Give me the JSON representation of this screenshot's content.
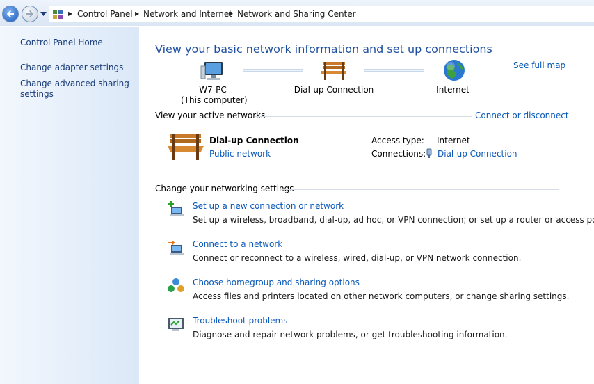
{
  "breadcrumb": {
    "items": [
      "Control Panel",
      "Network and Internet",
      "Network and Sharing Center"
    ]
  },
  "sidebar": {
    "items": [
      {
        "label": "Control Panel Home"
      },
      {
        "label": "Change adapter settings"
      },
      {
        "label": "Change advanced sharing settings"
      }
    ]
  },
  "main": {
    "title": "View your basic network information and set up connections",
    "see_full_map": "See full map",
    "map": {
      "computer_name": "W7-PC",
      "computer_sub": "(This computer)",
      "middle": "Dial-up Connection",
      "internet": "Internet"
    },
    "active_networks": {
      "heading": "View your active networks",
      "connect_link": "Connect or disconnect",
      "network_name": "Dial-up Connection",
      "network_type": "Public network",
      "access_type_label": "Access type:",
      "access_type_value": "Internet",
      "connections_label": "Connections:",
      "connections_value": "Dial-up Connection"
    },
    "settings": {
      "heading": "Change your networking settings",
      "tasks": [
        {
          "link": "Set up a new connection or network",
          "desc": "Set up a wireless, broadband, dial-up, ad hoc, or VPN connection; or set up a router or access point.",
          "icon": "new-connection-icon"
        },
        {
          "link": "Connect to a network",
          "desc": "Connect or reconnect to a wireless, wired, dial-up, or VPN network connection.",
          "icon": "connect-network-icon"
        },
        {
          "link": "Choose homegroup and sharing options",
          "desc": "Access files and printers located on other network computers, or change sharing settings.",
          "icon": "homegroup-icon"
        },
        {
          "link": "Troubleshoot problems",
          "desc": "Diagnose and repair network problems, or get troubleshooting information.",
          "icon": "troubleshoot-icon"
        }
      ]
    }
  },
  "colors": {
    "link": "#0a58b8",
    "title": "#1e4f9f",
    "sidebar_bg": "#dbe8f8"
  }
}
